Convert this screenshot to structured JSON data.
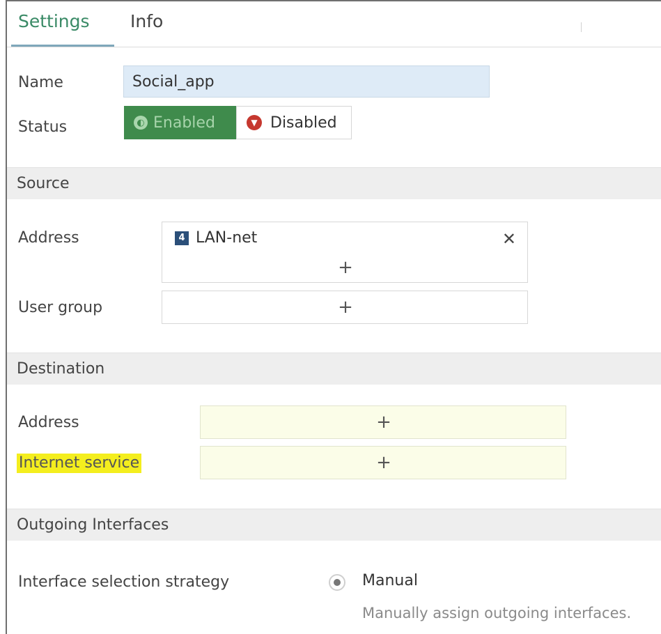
{
  "tabs": {
    "settings": "Settings",
    "info": "Info"
  },
  "name": {
    "label": "Name",
    "value": "Social_app"
  },
  "status": {
    "label": "Status",
    "enabled": "Enabled",
    "disabled": "Disabled"
  },
  "source": {
    "header": "Source",
    "address_label": "Address",
    "address_item": {
      "icon_glyph": "4",
      "text": "LAN-net"
    },
    "user_group_label": "User group"
  },
  "destination": {
    "header": "Destination",
    "address_label": "Address",
    "internet_service_label": "Internet service"
  },
  "outgoing": {
    "header": "Outgoing Interfaces",
    "strategy_label": "Interface selection strategy",
    "option_label": "Manual",
    "option_hint": "Manually assign outgoing interfaces."
  },
  "glyphs": {
    "plus": "+",
    "remove": "✕",
    "enabled_icon": "◐",
    "disabled_icon": "▼"
  },
  "colors": {
    "enabled_bg": "#3f8b4c",
    "disabled_icon": "#c6382f",
    "highlight": "#f4ee1e",
    "tab_active": "#3a8a66"
  }
}
